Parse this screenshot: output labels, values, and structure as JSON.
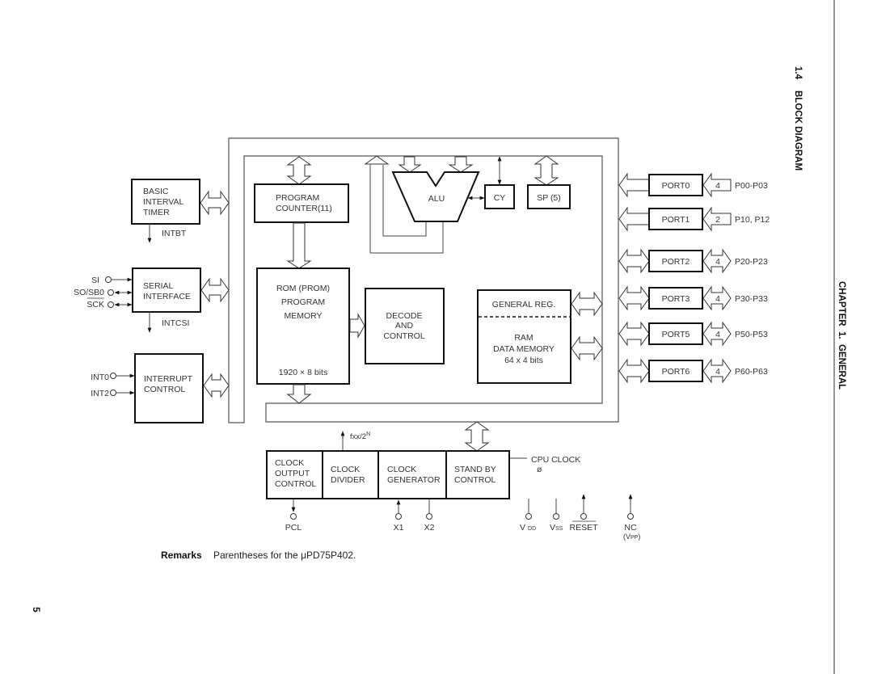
{
  "header": {
    "section": "1.4",
    "section_title": "BLOCK DIAGRAM",
    "chapter": "CHAPTER  1.  GENERAL",
    "page_number": "5"
  },
  "blocks": {
    "basic_interval_timer": [
      "BASIC",
      "INTERVAL",
      "TIMER"
    ],
    "intbt": "INTBT",
    "serial_interface": [
      "SERIAL",
      "INTERFACE"
    ],
    "intcsi": "INTCSI",
    "serial_pins": [
      "SI",
      "SO/SB0",
      "SCK"
    ],
    "interrupt_control": [
      "INTERRUPT",
      "CONTROL"
    ],
    "interrupt_pins": [
      "INT0",
      "INT2"
    ],
    "program_counter": [
      "PROGRAM",
      "COUNTER(11)"
    ],
    "rom": [
      "ROM (PROM)",
      "PROGRAM",
      "MEMORY"
    ],
    "rom_size": "1920 × 8 bits",
    "decode": [
      "DECODE",
      "AND",
      "CONTROL"
    ],
    "alu": "ALU",
    "cy": "CY",
    "sp": "SP (5)",
    "general_reg": "GENERAL REG.",
    "ram": [
      "RAM",
      "DATA MEMORY",
      "64 x 4 bits"
    ],
    "clock_output": [
      "CLOCK",
      "OUTPUT",
      "CONTROL"
    ],
    "clock_divider": [
      "CLOCK",
      "DIVIDER"
    ],
    "clock_generator": [
      "CLOCK",
      "GENERATOR"
    ],
    "standby": [
      "STAND BY",
      "CONTROL"
    ],
    "fxx": "fxx/2",
    "fxx_sup": "N",
    "cpu_clock": "CPU CLOCK",
    "phi": "ø"
  },
  "ports": [
    {
      "name": "PORT0",
      "width": "4",
      "pins": "P00-P03",
      "direction": "in"
    },
    {
      "name": "PORT1",
      "width": "2",
      "pins": "P10, P12",
      "direction": "in"
    },
    {
      "name": "PORT2",
      "width": "4",
      "pins": "P20-P23",
      "direction": "bi"
    },
    {
      "name": "PORT3",
      "width": "4",
      "pins": "P30-P33",
      "direction": "bi"
    },
    {
      "name": "PORT5",
      "width": "4",
      "pins": "P50-P53",
      "direction": "bi"
    },
    {
      "name": "PORT6",
      "width": "4",
      "pins": "P60-P63",
      "direction": "bi"
    }
  ],
  "bottom_pins": {
    "pcl": "PCL",
    "x1": "X1",
    "x2": "X2",
    "vdd": "V",
    "vdd_sub": "DD",
    "vss": "V",
    "vss_sub": "SS",
    "reset": "RESET",
    "nc": "NC",
    "vpp": "(V",
    "vpp_sub": "PP",
    "vpp_close": ")"
  },
  "remarks": {
    "label": "Remarks",
    "text": "Parentheses for the μPD75P402."
  }
}
